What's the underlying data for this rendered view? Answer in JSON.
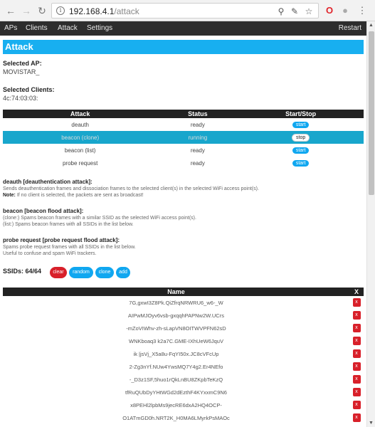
{
  "browser": {
    "url_host": "192.168.4.1",
    "url_path": "/attack",
    "info_icon": "i"
  },
  "nav": {
    "items": [
      "APs",
      "Clients",
      "Attack",
      "Settings"
    ],
    "restart": "Restart"
  },
  "page": {
    "title": "Attack",
    "selected_ap_label": "Selected AP:",
    "selected_ap_value": "MOVISTAR_",
    "selected_clients_label": "Selected Clients:",
    "selected_clients_value": "4c:74:03:03:"
  },
  "attack_table": {
    "headers": [
      "Attack",
      "Status",
      "Start/Stop"
    ],
    "rows": [
      {
        "attack": "deauth",
        "status": "ready",
        "action": "start"
      },
      {
        "attack": "beacon (clone)",
        "status": "running",
        "action": "stop"
      },
      {
        "attack": "beacon (list)",
        "status": "ready",
        "action": "start"
      },
      {
        "attack": "probe request",
        "status": "ready",
        "action": "start"
      }
    ]
  },
  "descriptions": {
    "deauth_title": "deauth [deauthentication attack]:",
    "deauth_line1": "Sends deauthentication frames and dissociation frames to the selected client(s) in the selected WiFi access point(s).",
    "deauth_note_label": "Note:",
    "deauth_note": " If no client is selected, the packets are sent as broadcast!",
    "beacon_title": "beacon [beacon flood attack]:",
    "beacon_line1": "(clone:) Spams beacon frames with a similar SSID as the selected WiFi access point(s).",
    "beacon_line2": "(list:) Spams beacon frames with all SSIDs in the list below.",
    "probe_title": "probe request [probe request flood attack]:",
    "probe_line1": "Spams probe request frames with all SSIDs in the list below.",
    "probe_line2": "Useful to confuse and spam WiFi trackers."
  },
  "ssids": {
    "label": "SSIDs: 64/64",
    "buttons": {
      "clear": "clear",
      "random": "random",
      "clone": "clone",
      "add": "add"
    },
    "headers": {
      "name": "Name",
      "x": "X"
    },
    "delete_label": "x",
    "rows": [
      "7G,gxwI3Z8Pk.QiZfrqNRWRU6_w6-_W",
      "AIPwMJOyv6vsb-gxqqhPAPNw2W.UCrs",
      "-mZoVIWhv-zh-sLapVN8OITWVPFN62sD",
      "WNKboaq3 k2a7C.GME-IXhUeW6JquV",
      "ik |jsVj_X5a8u-FqYI50x.JC8cVFcUp",
      "2-Zg3nYf.NUw4YwsMQ7Y4g2.Er4NEfo",
      "-_D3z1SF,5huo1rQkLnBU8ZKpbTeKzQ",
      "tfRuQUbDyYHtWGd2dEzthF4KYxxmC9N6",
      "x8PEHl2lpbMs9jecRE6dxA2HQ4OCP-",
      "O1ATmGD0h.NRT2K_H0MA6LMyrkPsMAOc"
    ]
  }
}
